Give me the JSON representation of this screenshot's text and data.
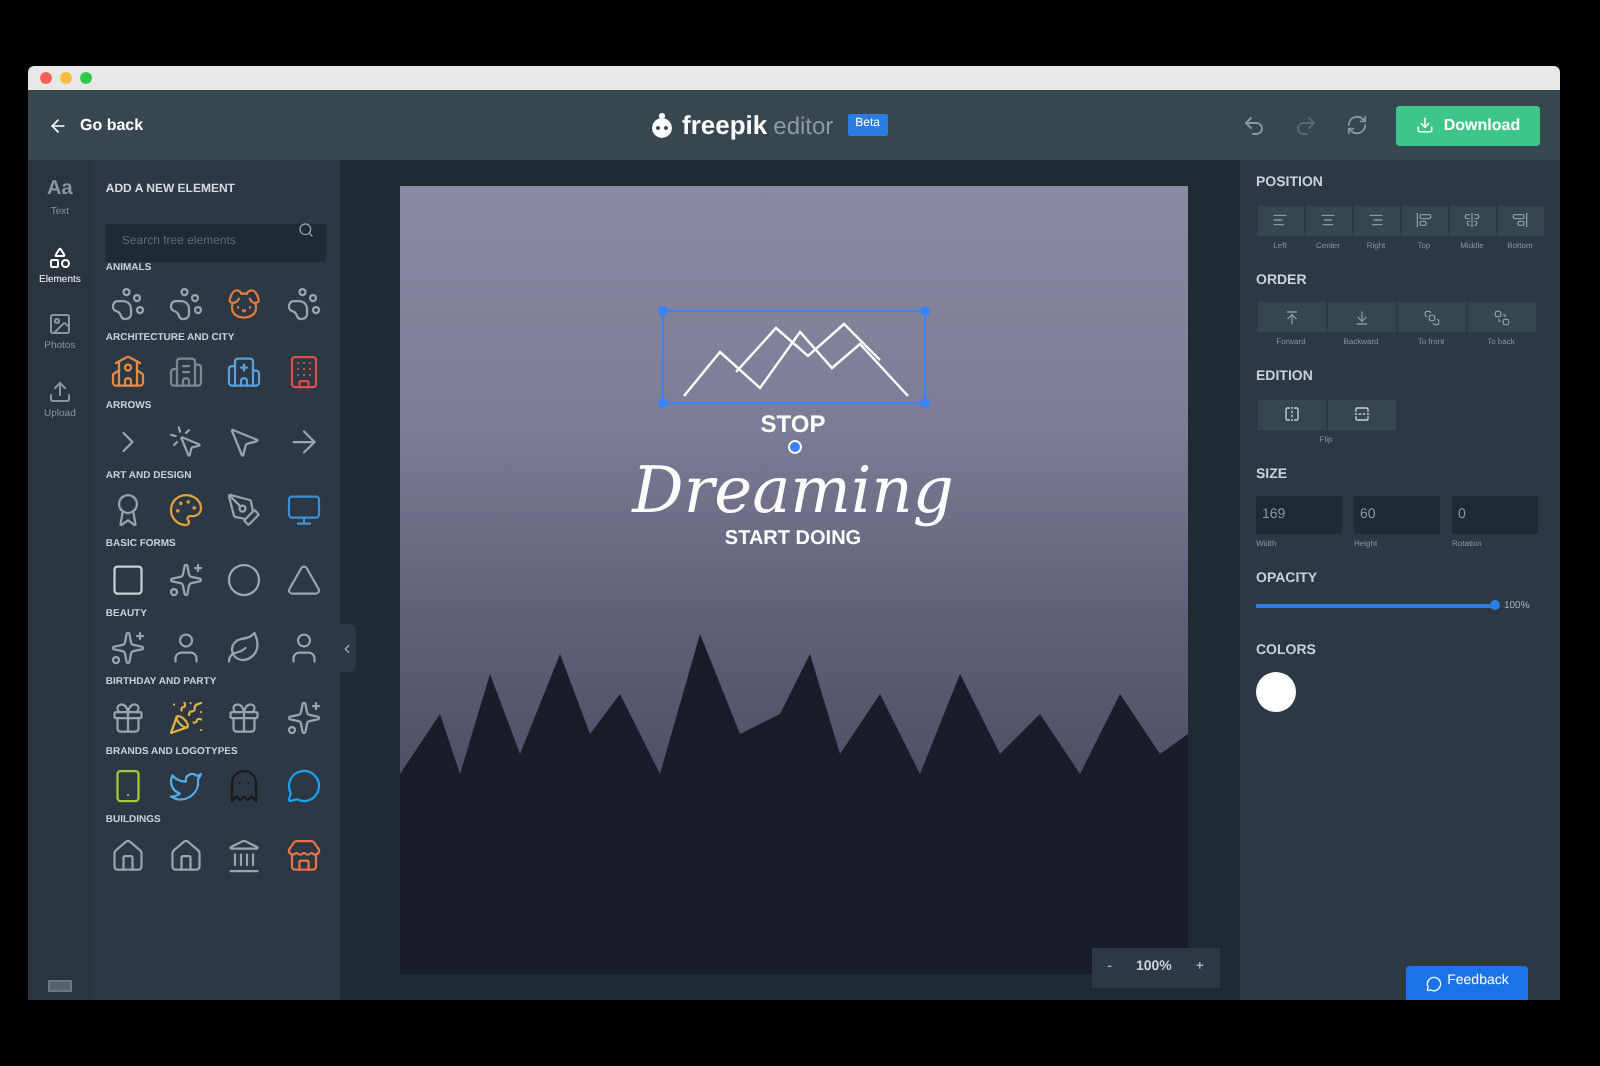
{
  "header": {
    "back": "Go back",
    "logo_word": "freepik",
    "logo_suffix": "editor",
    "badge": "Beta",
    "download": "Download"
  },
  "rail": [
    {
      "kind": "text",
      "glyph": "Aa",
      "label": "Text",
      "selected": false
    },
    {
      "kind": "elements",
      "label": "Elements",
      "selected": true
    },
    {
      "kind": "photos",
      "label": "Photos",
      "selected": false
    },
    {
      "kind": "upload",
      "label": "Upload",
      "selected": false
    }
  ],
  "elements_panel": {
    "title": "ADD A NEW ELEMENT",
    "search": {
      "placeholder": "Search free elements"
    },
    "categories": [
      {
        "name": "ANIMALS"
      },
      {
        "name": "ARCHITECTURE AND CITY"
      },
      {
        "name": "ARROWS"
      },
      {
        "name": "ART AND DESIGN"
      },
      {
        "name": "BASIC FORMS"
      },
      {
        "name": "BEAUTY"
      },
      {
        "name": "BIRTHDAY AND PARTY"
      },
      {
        "name": "BRANDS AND LOGOTYPES"
      },
      {
        "name": "BUILDINGS"
      }
    ]
  },
  "canvas": {
    "line_1": "STOP",
    "line_2": "Dreaming",
    "line_3": "START DOING",
    "zoom": {
      "minus": "-",
      "value": "100%",
      "plus": "+"
    }
  },
  "properties": {
    "position": {
      "title": "POSITION",
      "buttons": [
        "Left",
        "Center",
        "Right",
        "Top",
        "Middle",
        "Bottom"
      ]
    },
    "order": {
      "title": "ORDER",
      "buttons": [
        "Forward",
        "Backward",
        "To front",
        "To back"
      ]
    },
    "edition": {
      "title": "EDITION",
      "label": "Flip"
    },
    "size": {
      "title": "SIZE",
      "fields": [
        {
          "label": "Width",
          "value": "169"
        },
        {
          "label": "Height",
          "value": "60"
        },
        {
          "label": "Rotation",
          "value": "0"
        }
      ]
    },
    "opacity": {
      "title": "OPACITY",
      "level": 1,
      "reading": "100%"
    },
    "colors": {
      "title": "COLORS",
      "swatches": [
        {
          "color": "#ffffff"
        }
      ]
    }
  },
  "feedback": "Feedback"
}
